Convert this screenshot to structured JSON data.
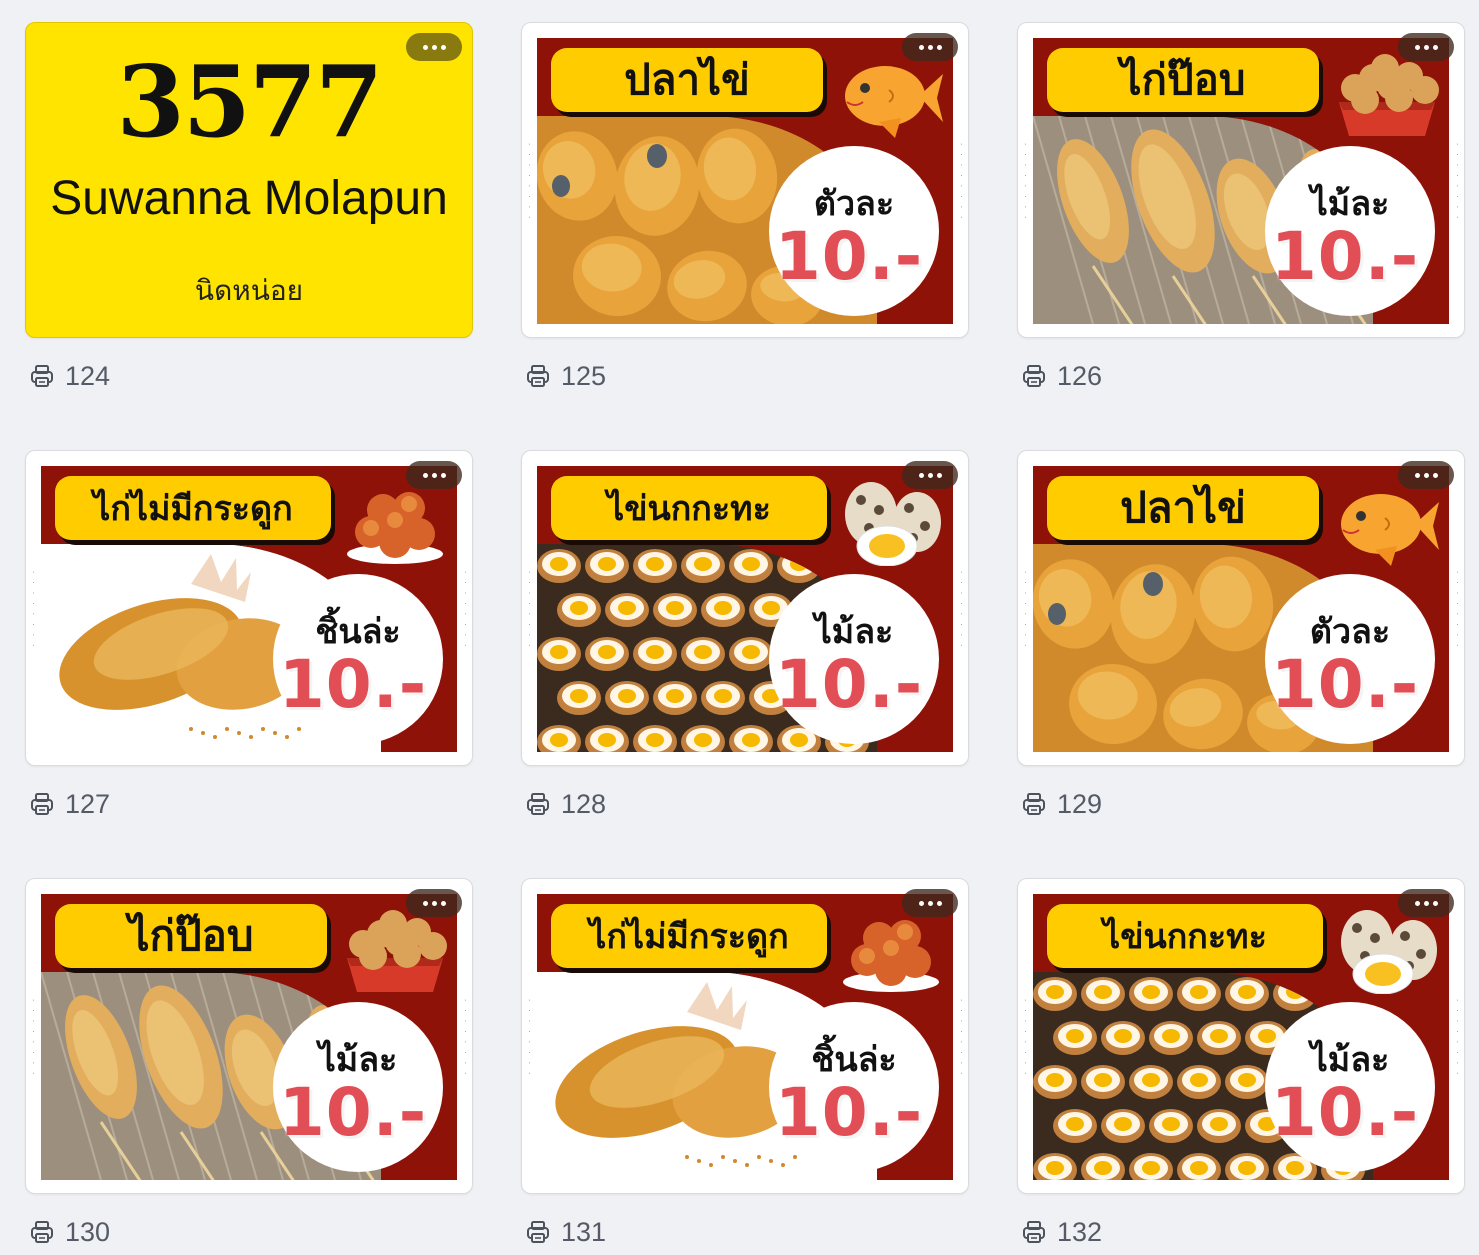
{
  "cards": [
    {
      "kind": "text",
      "big": "3577",
      "name": "Suwanna Molapun",
      "sub": "นิดหน่อย",
      "count": "124"
    },
    {
      "kind": "food",
      "title": "ปลาไข่",
      "unit": "ตัวละ",
      "price": "10.-",
      "food": "fish-roe",
      "count": "125"
    },
    {
      "kind": "food",
      "title": "ไก่ป๊อบ",
      "unit": "ไม้ละ",
      "price": "10.-",
      "food": "popcorn-chicken",
      "count": "126"
    },
    {
      "kind": "food",
      "title": "ไก่ไม่มีกระดูก",
      "unit": "ชิ้นล่ะ",
      "price": "10.-",
      "food": "boneless-chicken",
      "count": "127"
    },
    {
      "kind": "food",
      "title": "ไข่นกกะทะ",
      "unit": "ไม้ละ",
      "price": "10.-",
      "food": "quail-eggs",
      "count": "128"
    },
    {
      "kind": "food",
      "title": "ปลาไข่",
      "unit": "ตัวละ",
      "price": "10.-",
      "food": "fish-roe",
      "count": "129"
    },
    {
      "kind": "food",
      "title": "ไก่ป๊อบ",
      "unit": "ไม้ละ",
      "price": "10.-",
      "food": "popcorn-chicken",
      "count": "130"
    },
    {
      "kind": "food",
      "title": "ไก่ไม่มีกระดูก",
      "unit": "ชิ้นล่ะ",
      "price": "10.-",
      "food": "boneless-chicken",
      "count": "131"
    },
    {
      "kind": "food",
      "title": "ไข่นกกะทะ",
      "unit": "ไม้ละ",
      "price": "10.-",
      "food": "quail-eggs",
      "count": "132"
    }
  ],
  "icons": {
    "more": "more-options-icon",
    "print": "printer-icon"
  },
  "colors": {
    "poster_bg": "#8e1208",
    "pill": "#ffcc00",
    "price": "#e24e55",
    "yellow_card": "#ffe400",
    "page_bg": "#f0f1f5"
  }
}
